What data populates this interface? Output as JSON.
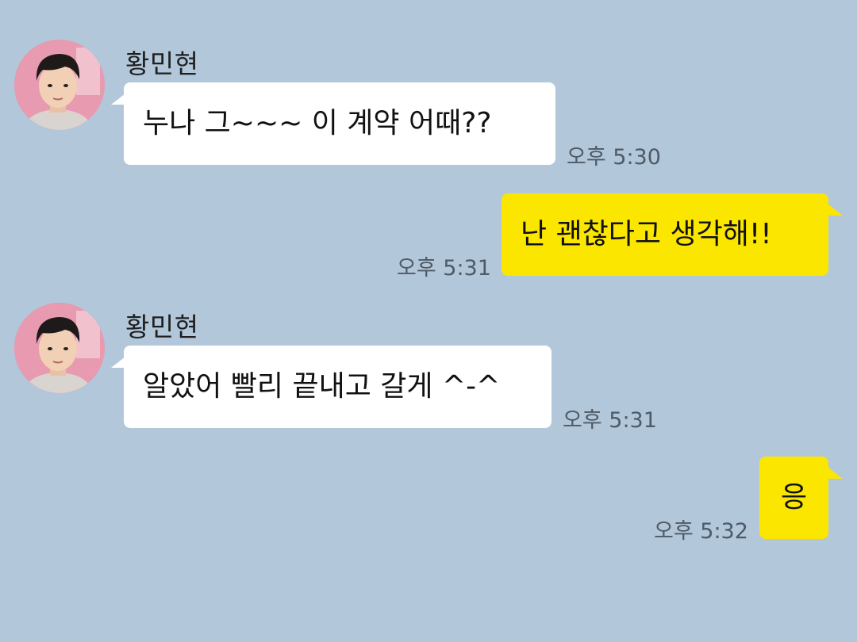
{
  "colors": {
    "background": "#b2c7da",
    "incoming_bubble": "#ffffff",
    "outgoing_bubble": "#fbe600",
    "timestamp": "#4e5a66"
  },
  "messages": [
    {
      "direction": "incoming",
      "sender": "황민현",
      "avatar_icon": "profile-photo-icon",
      "text": "누나 그~~~ 이 계약 어때??",
      "time": "오후 5:30"
    },
    {
      "direction": "outgoing",
      "text": "난 괜찮다고 생각해!!",
      "time": "오후 5:31"
    },
    {
      "direction": "incoming",
      "sender": "황민현",
      "avatar_icon": "profile-photo-icon",
      "text": "알았어 빨리 끝내고 갈게 ^-^",
      "time": "오후 5:31"
    },
    {
      "direction": "outgoing",
      "text": "응",
      "time": "오후 5:32"
    }
  ]
}
